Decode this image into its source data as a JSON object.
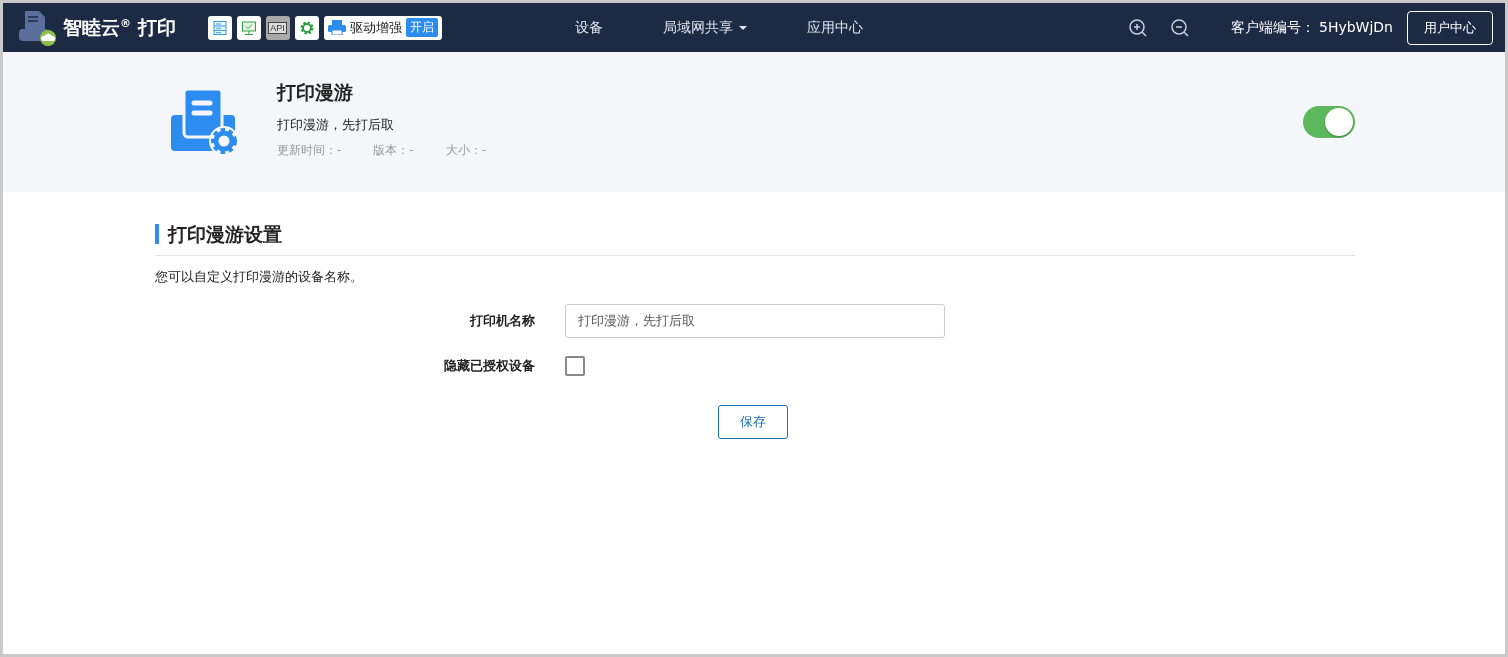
{
  "header": {
    "brand": "智睦云$^{®}$ 打印",
    "tools": [
      {
        "kind": "server",
        "disabled": false
      },
      {
        "kind": "monitor",
        "disabled": false
      },
      {
        "kind": "api",
        "label": "API",
        "disabled": true
      },
      {
        "kind": "gear",
        "disabled": false
      }
    ],
    "driver": {
      "label": "驱动增强",
      "badge": "开启",
      "on": true
    },
    "nav": [
      {
        "label": "设备",
        "dropdown": false
      },
      {
        "label": "局域网共享",
        "dropdown": true
      },
      {
        "label": "应用中心",
        "dropdown": false
      }
    ],
    "client_label": "客户端编号：",
    "client_id": "5HybWjDn",
    "user_button": "用户中心"
  },
  "app": {
    "title": "打印漫游",
    "subtitle": "打印漫游，先打后取",
    "meta": [
      "更新时间：-",
      "版本：-",
      "大小：-"
    ],
    "enabled": true
  },
  "settings": {
    "title": "打印漫游设置",
    "description": "您可以自定义打印漫游的设备名称。",
    "printer_name": {
      "label": "打印机名称",
      "value": "打印漫游，先打后取"
    },
    "hide_authorized": {
      "label": "隐藏已授权设备",
      "checked": false
    },
    "save": "保存"
  }
}
